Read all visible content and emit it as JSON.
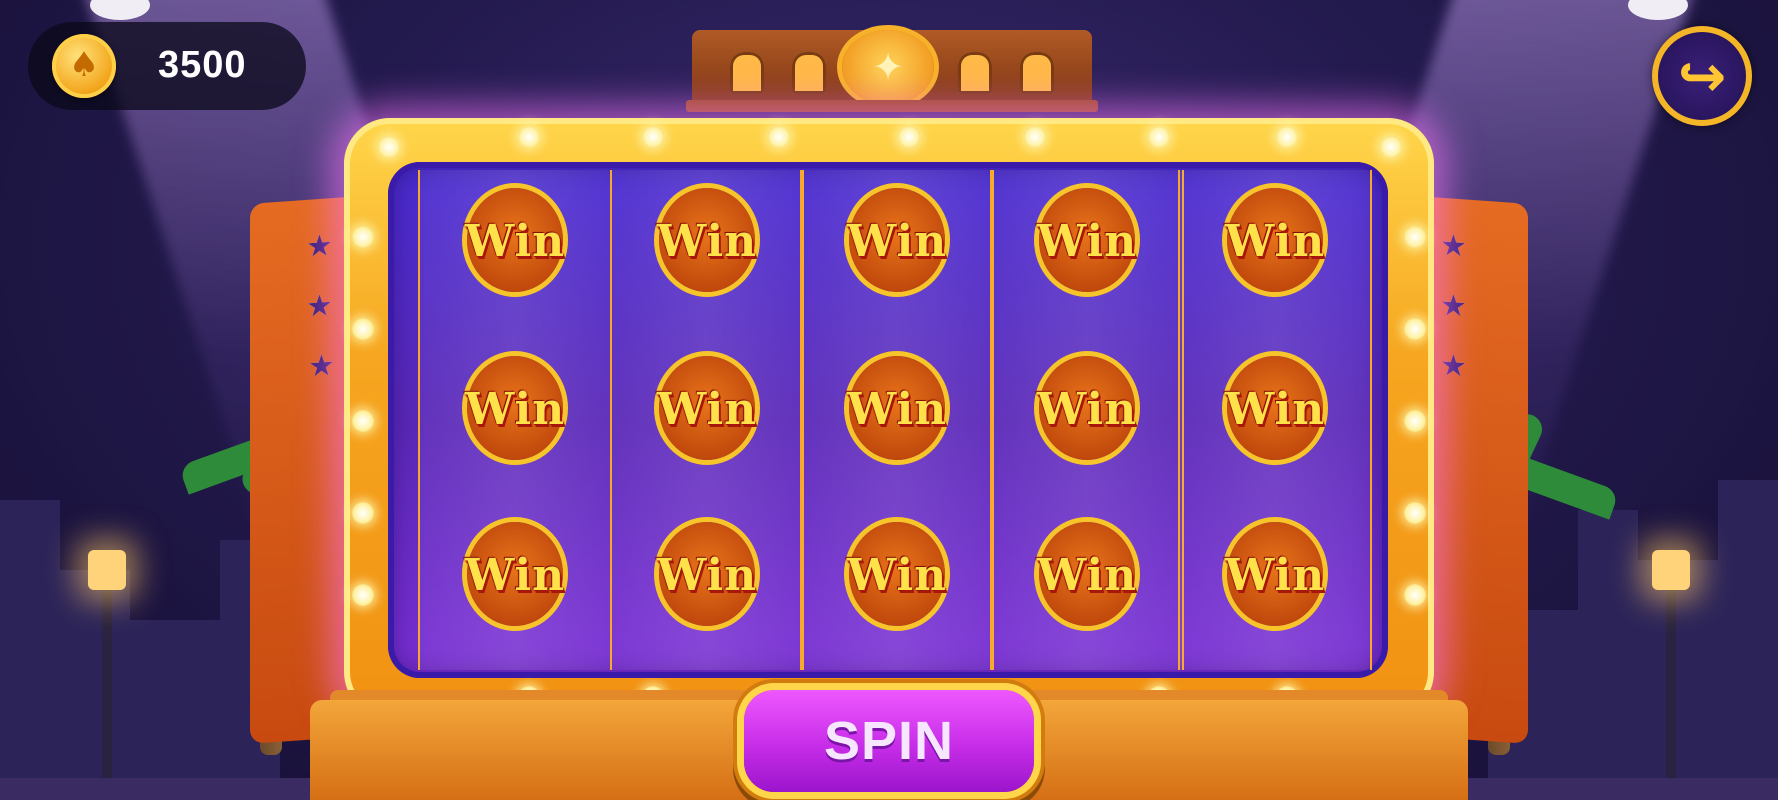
{
  "hud": {
    "coin_icon": "coin-icon",
    "balance": "3500",
    "share_icon": "share-arrow-icon"
  },
  "slot_machine": {
    "reels": [
      [
        "WIN",
        "WIN",
        "WIN"
      ],
      [
        "WIN",
        "WIN",
        "WIN"
      ],
      [
        "WIN",
        "WIN",
        "WIN"
      ],
      [
        "WIN",
        "WIN",
        "WIN"
      ],
      [
        "WIN",
        "WIN",
        "WIN"
      ]
    ],
    "symbol_text": "Win",
    "spin_label": "SPIN"
  },
  "colors": {
    "frame_gold": "#f6a620",
    "reel_purple": "#5a28b8",
    "spin_magenta": "#c72de8",
    "glow": "#ff78ff"
  }
}
